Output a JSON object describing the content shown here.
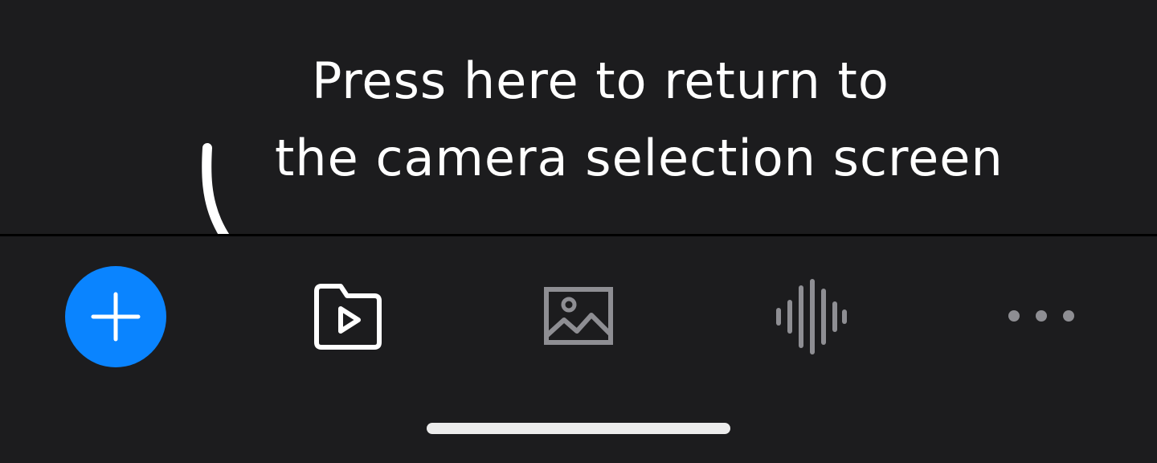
{
  "annotation": {
    "line1": "Press here to return to",
    "line2": "the camera selection screen"
  },
  "tabbar": {
    "add_button": {
      "icon": "plus-icon",
      "color": "#0a84ff"
    },
    "tabs": [
      {
        "icon": "folder-play-icon",
        "active": true
      },
      {
        "icon": "image-icon",
        "active": false
      },
      {
        "icon": "waveform-icon",
        "active": false
      },
      {
        "icon": "more-horizontal-icon",
        "active": false
      }
    ],
    "active_color": "#ffffff",
    "inactive_color": "#8e8e93"
  }
}
